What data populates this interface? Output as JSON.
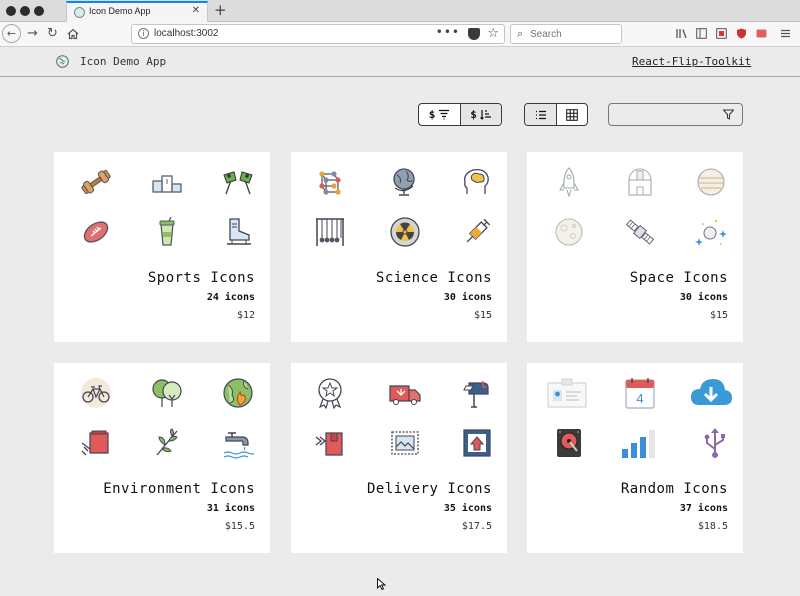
{
  "browser": {
    "tab_title": "Icon Demo App",
    "tab_close": "✕",
    "new_tab": "+",
    "url": "localhost:3002",
    "search_placeholder": "Search"
  },
  "app": {
    "title": "Icon Demo App",
    "link": "React-Flip-Toolkit"
  },
  "sort_buttons": [
    {
      "label": "$",
      "icon": "sort-descending-icon",
      "active": true
    },
    {
      "label": "$",
      "icon": "sort-ascending-icon",
      "active": false
    }
  ],
  "view_buttons": [
    {
      "icon": "list-view-icon",
      "active": false
    },
    {
      "icon": "grid-view-icon",
      "active": true
    }
  ],
  "filter": {
    "value": "",
    "icon": "filter-icon"
  },
  "cards": [
    {
      "title": "Sports Icons",
      "count": "24 icons",
      "price": "$12",
      "icons": [
        "dumbbell-icon",
        "podium-icon",
        "racing-flags-icon",
        "football-icon",
        "water-bottle-icon",
        "ice-skate-icon"
      ]
    },
    {
      "title": "Science Icons",
      "count": "30 icons",
      "price": "$15",
      "icons": [
        "molecule-icon",
        "globe-icon",
        "brain-icon",
        "newtons-cradle-icon",
        "radiation-icon",
        "syringe-icon"
      ]
    },
    {
      "title": "Space Icons",
      "count": "30 icons",
      "price": "$15",
      "icons": [
        "rocket-icon",
        "observatory-icon",
        "planet-icon",
        "moon-icon",
        "satellite-icon",
        "stars-icon"
      ]
    },
    {
      "title": "Environment Icons",
      "count": "31 icons",
      "price": "$15.5",
      "icons": [
        "bicycle-icon",
        "trees-icon",
        "burning-earth-icon",
        "recycling-bin-icon",
        "sprout-icon",
        "faucet-icon"
      ]
    },
    {
      "title": "Delivery Icons",
      "count": "35 icons",
      "price": "$17.5",
      "icons": [
        "award-badge-icon",
        "delivery-truck-icon",
        "mailbox-icon",
        "fast-package-icon",
        "stamp-icon",
        "upload-box-icon"
      ]
    },
    {
      "title": "Random Icons",
      "count": "37 icons",
      "price": "$18.5",
      "icons": [
        "id-card-icon",
        "calendar-icon",
        "cloud-download-icon",
        "hard-drive-icon",
        "signal-bars-icon",
        "usb-icon"
      ]
    }
  ],
  "icon_glyphs": {
    "calendar_day": "4"
  },
  "colors": {
    "accent_tab": "#0a84ff",
    "card_bg": "#ffffff",
    "page_bg": "#ebebeb"
  }
}
